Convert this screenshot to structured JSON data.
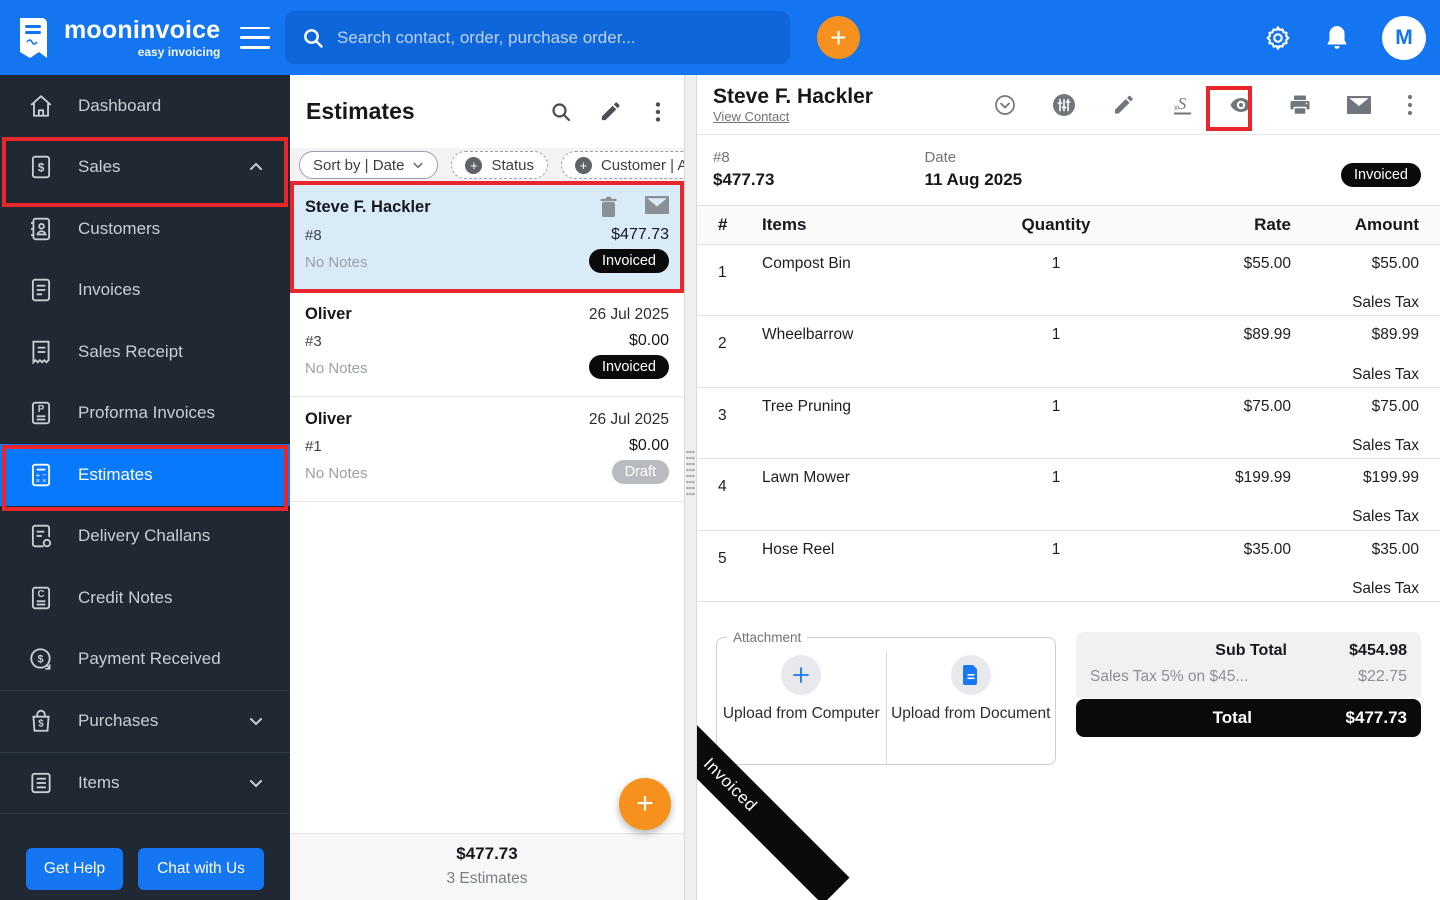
{
  "header": {
    "logo_title": "mooninvoice",
    "logo_subtitle": "easy invoicing",
    "search_placeholder": "Search contact, order, purchase order...",
    "avatar_initial": "M"
  },
  "sidebar": {
    "items": [
      {
        "label": "Dashboard"
      },
      {
        "label": "Sales"
      },
      {
        "label": "Customers"
      },
      {
        "label": "Invoices"
      },
      {
        "label": "Sales Receipt"
      },
      {
        "label": "Proforma Invoices"
      },
      {
        "label": "Estimates"
      },
      {
        "label": "Delivery Challans"
      },
      {
        "label": "Credit Notes"
      },
      {
        "label": "Payment Received"
      },
      {
        "label": "Purchases"
      },
      {
        "label": "Items"
      }
    ],
    "get_help_label": "Get Help",
    "chat_label": "Chat with Us"
  },
  "list_panel": {
    "title": "Estimates",
    "filters": {
      "sort": "Sort by | Date",
      "status": "Status",
      "customer": "Customer | A"
    },
    "estimates": [
      {
        "name": "Steve F. Hackler",
        "number": "#8",
        "amount": "$477.73",
        "notes": "No Notes",
        "status": "Invoiced"
      },
      {
        "name": "Oliver",
        "number": "#3",
        "date": "26 Jul 2025",
        "amount": "$0.00",
        "notes": "No Notes",
        "status": "Invoiced"
      },
      {
        "name": "Oliver",
        "number": "#1",
        "date": "26 Jul 2025",
        "amount": "$0.00",
        "notes": "No Notes",
        "status": "Draft"
      }
    ],
    "footer_total": "$477.73",
    "footer_count": "3 Estimates"
  },
  "detail_panel": {
    "customer_name": "Steve F. Hackler",
    "view_contact_label": "View Contact",
    "number": "#8",
    "amount": "$477.73",
    "date_label": "Date",
    "date_value": "11 Aug 2025",
    "status": "Invoiced",
    "table": {
      "headers": {
        "hash": "#",
        "items": "Items",
        "quantity": "Quantity",
        "rate": "Rate",
        "amount": "Amount"
      },
      "rows": [
        {
          "num": "1",
          "item": "Compost Bin",
          "qty": "1",
          "rate": "$55.00",
          "amount": "$55.00",
          "tax": "Sales Tax"
        },
        {
          "num": "2",
          "item": "Wheelbarrow",
          "qty": "1",
          "rate": "$89.99",
          "amount": "$89.99",
          "tax": "Sales Tax"
        },
        {
          "num": "3",
          "item": "Tree Pruning",
          "qty": "1",
          "rate": "$75.00",
          "amount": "$75.00",
          "tax": "Sales Tax"
        },
        {
          "num": "4",
          "item": "Lawn Mower",
          "qty": "1",
          "rate": "$199.99",
          "amount": "$199.99",
          "tax": "Sales Tax"
        },
        {
          "num": "5",
          "item": "Hose Reel",
          "qty": "1",
          "rate": "$35.00",
          "amount": "$35.00",
          "tax": "Sales Tax"
        }
      ]
    },
    "attachment": {
      "legend": "Attachment",
      "upload_computer": "Upload from Computer",
      "upload_document": "Upload from Document"
    },
    "totals": {
      "subtotal_label": "Sub Total",
      "subtotal_value": "$454.98",
      "tax_label": "Sales Tax 5% on $45...",
      "tax_value": "$22.75",
      "total_label": "Total",
      "total_value": "$477.73"
    },
    "ribbon": "Invoiced"
  },
  "colors": {
    "header_blue": "#1375F0",
    "active_blue": "#0879FB",
    "orange": "#F6911E",
    "annotation_red": "#E8262B",
    "status_black": "#0A0A0A"
  }
}
